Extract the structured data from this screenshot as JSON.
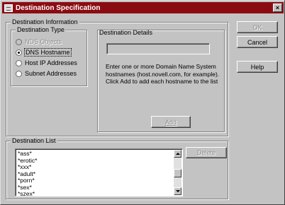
{
  "window": {
    "title": "Destination Specification",
    "close_label": "×"
  },
  "destination_information": {
    "legend": "Destination Information",
    "type_group": {
      "legend": "Destination Type",
      "options": [
        {
          "label": "NDS Objects",
          "selected": false,
          "enabled": false
        },
        {
          "label": "DNS Hostname",
          "selected": true,
          "enabled": true
        },
        {
          "label": "Host IP Addresses",
          "selected": false,
          "enabled": true
        },
        {
          "label": "Subnet Addresses",
          "selected": false,
          "enabled": true
        }
      ]
    },
    "details": {
      "label": "Destination Details",
      "input_value": "",
      "help_lines": [
        "Enter one or more Domain Name System",
        "hostnames (host.novell.com, for example).",
        "Click Add to add each hostname to the list"
      ],
      "add_label": "Add"
    }
  },
  "destination_list": {
    "legend": "Destination List",
    "items": [
      "*ass*",
      "*erotic*",
      "*xxx*",
      "*adult*",
      "*porn*",
      "*sex*",
      "*szex*"
    ],
    "delete_label": "Delete"
  },
  "buttons": {
    "ok": "OK",
    "cancel": "Cancel",
    "help": "Help"
  }
}
